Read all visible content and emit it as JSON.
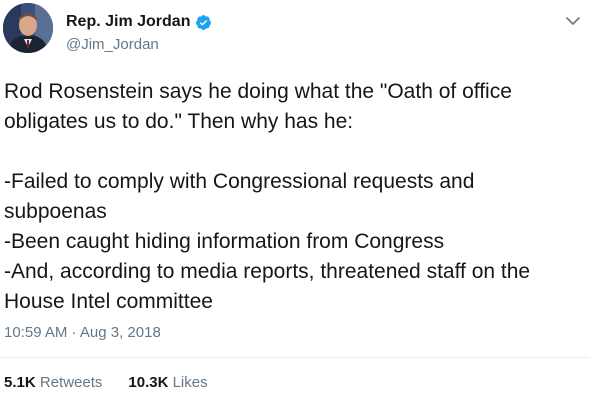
{
  "author": {
    "display_name": "Rep. Jim Jordan",
    "handle": "@Jim_Jordan",
    "verified": true,
    "avatar_icon": "profile-photo"
  },
  "menu_icon": "chevron-down-icon",
  "tweet": {
    "lines": [
      "Rod Rosenstein says he doing what the \"Oath of office",
      "obligates us to do.\" Then why has he:",
      "",
      "-Failed to comply with Congressional requests and",
      "subpoenas",
      "-Been caught hiding information from Congress",
      "-And, according to media reports, threatened staff on the",
      "House Intel committee"
    ],
    "timestamp": "10:59 AM · Aug 3, 2018"
  },
  "stats": {
    "retweets_count": "5.1K",
    "retweets_label": "Retweets",
    "likes_count": "10.3K",
    "likes_label": "Likes"
  },
  "colors": {
    "text_primary": "#14171a",
    "text_secondary": "#657786",
    "verified_blue": "#1da1f2",
    "divider": "#e6ecf0"
  }
}
